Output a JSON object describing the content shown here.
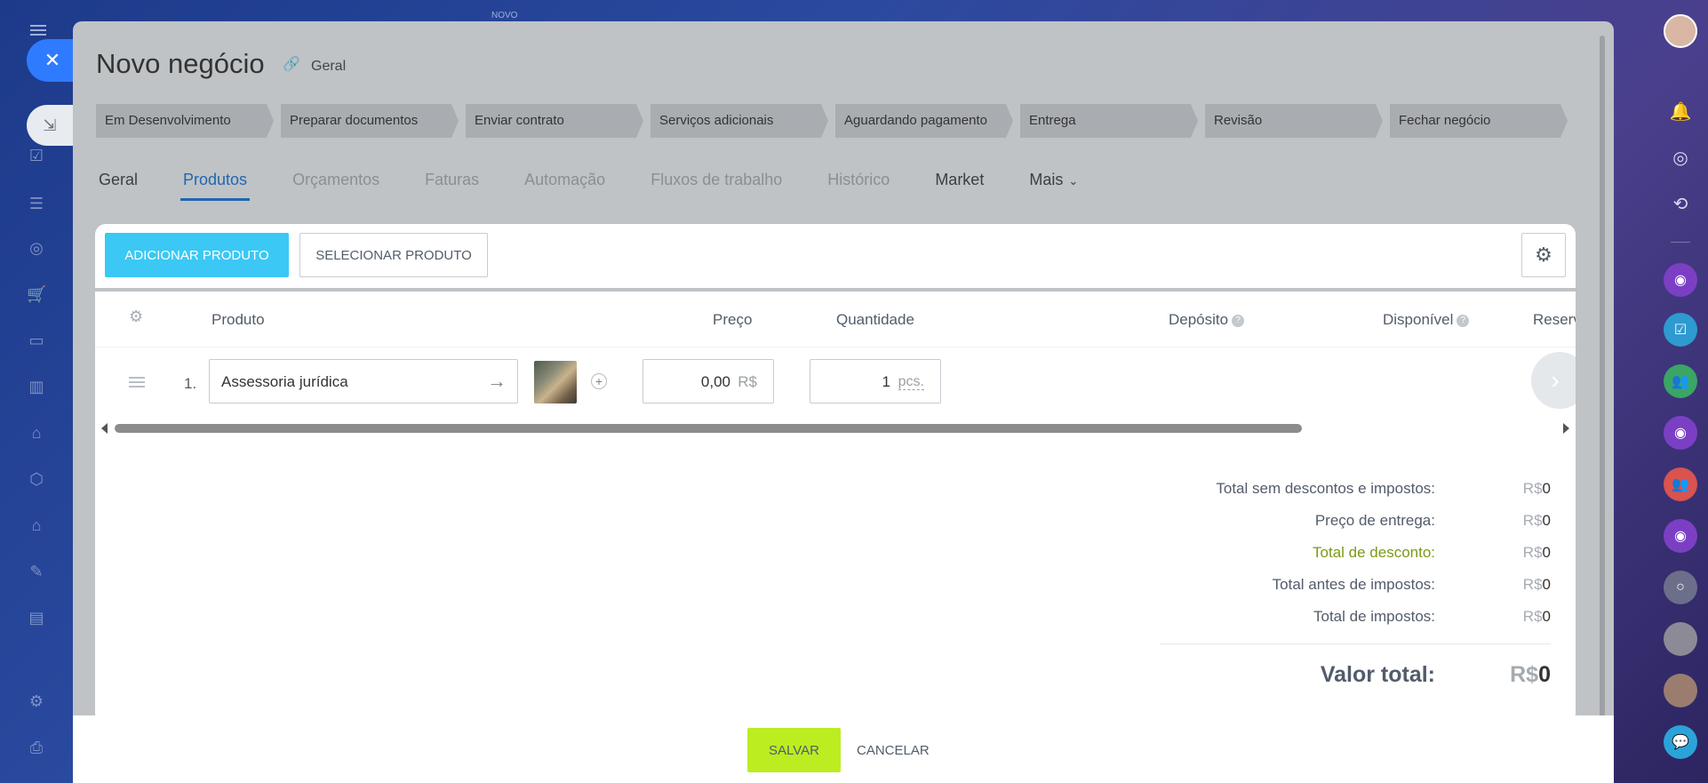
{
  "topbar": {
    "novo_label": "NOVO"
  },
  "deal": {
    "title": "Novo negócio",
    "category": "Geral"
  },
  "stages": [
    "Em Desenvolvimento",
    "Preparar documentos",
    "Enviar contrato",
    "Serviços adicionais",
    "Aguardando pagamento",
    "Entrega",
    "Revisão",
    "Fechar negócio"
  ],
  "tabs": [
    {
      "label": "Geral",
      "state": "dark"
    },
    {
      "label": "Produtos",
      "state": "active"
    },
    {
      "label": "Orçamentos",
      "state": "muted"
    },
    {
      "label": "Faturas",
      "state": "muted"
    },
    {
      "label": "Automação",
      "state": "muted"
    },
    {
      "label": "Fluxos de trabalho",
      "state": "muted"
    },
    {
      "label": "Histórico",
      "state": "muted"
    },
    {
      "label": "Market",
      "state": "dark"
    },
    {
      "label": "Mais",
      "state": "dark"
    }
  ],
  "toolbar": {
    "add_label": "ADICIONAR PRODUTO",
    "select_label": "SELECIONAR PRODUTO"
  },
  "table": {
    "headers": {
      "product": "Produto",
      "price": "Preço",
      "quantity": "Quantidade",
      "warehouse": "Depósito",
      "available": "Disponível",
      "reserved": "Reserv"
    },
    "rows": [
      {
        "index": "1.",
        "product": "Assessoria jurídica",
        "price": "0,00",
        "currency": "R$",
        "quantity": "1",
        "unit": "pcs."
      }
    ]
  },
  "totals": {
    "currency": "R$",
    "items": [
      {
        "label": "Total sem descontos e impostos:",
        "value": "0"
      },
      {
        "label": "Preço de entrega:",
        "value": "0"
      },
      {
        "label": "Total de desconto:",
        "value": "0"
      },
      {
        "label": "Total antes de impostos:",
        "value": "0"
      },
      {
        "label": "Total de impostos:",
        "value": "0"
      }
    ],
    "grand_label": "Valor total:",
    "grand_value": "0"
  },
  "footer": {
    "save_label": "SALVAR",
    "cancel_label": "CANCELAR"
  },
  "colors": {
    "accent": "#2067b0",
    "add_button": "#3bc8f5",
    "save_button": "#bbed21",
    "discount_label": "#7a9a15"
  }
}
